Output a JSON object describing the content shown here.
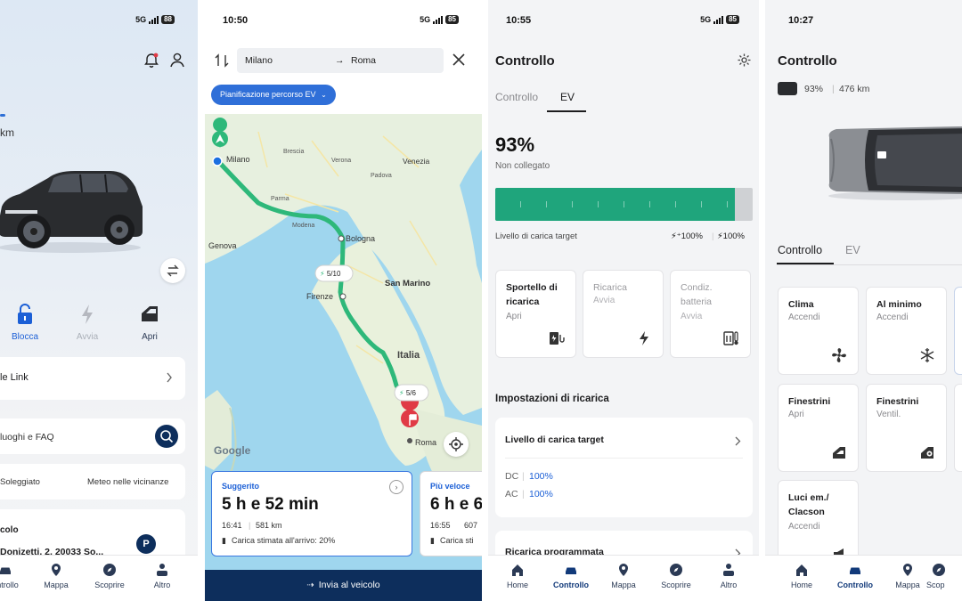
{
  "colors": {
    "ev_green": "#1fa57c",
    "brand_navy": "#0d2e5c",
    "route_green": "#2eb87a",
    "link_blue": "#1b5fd6",
    "map_pin_red": "#e03a45"
  },
  "screen1": {
    "status": {
      "network": "5G",
      "battery": "88"
    },
    "range_fragment": "km",
    "actions": [
      {
        "label": "Blocca",
        "icon": "lock-icon",
        "state": "active"
      },
      {
        "label": "Avvia",
        "icon": "bolt-icon",
        "state": "disabled"
      },
      {
        "label": "Apri",
        "icon": "door-icon",
        "state": "normal"
      }
    ],
    "link_row": "le Link",
    "faq_placeholder": "luoghi e FAQ",
    "weather": {
      "left": "Soleggiato",
      "right": "Meteo nelle vicinanze"
    },
    "location": {
      "title": "colo",
      "address": "Donizetti, 2, 20033 So..."
    },
    "tabs": [
      "ontrollo",
      "Mappa",
      "Scoprire",
      "Altro"
    ]
  },
  "screen2": {
    "status": {
      "time": "10:50",
      "network": "5G",
      "battery": "85"
    },
    "route": {
      "from": "Milano",
      "to": "Roma"
    },
    "chip": "Pianificazione percorso EV",
    "map_labels": {
      "cities": [
        "Milano",
        "Bologna",
        "Genova",
        "Firenze",
        "San Marino",
        "Italia",
        "Roma",
        "Venezia",
        "Modena",
        "Brescia",
        "Verona",
        "Padova",
        "Parma"
      ],
      "stops": [
        "5/10",
        "5/6"
      ],
      "brand": "Google"
    },
    "suggested": {
      "tag": "Suggerito",
      "duration": "5 h e 52 min",
      "arrival": "16:41",
      "distance": "581 km",
      "charge": "Carica stimata all'arrivo: 20%"
    },
    "faster": {
      "tag": "Più veloce",
      "duration": "6 h e 6",
      "arrival": "16:55",
      "distance": "607",
      "charge": "Carica sti"
    },
    "send_button": "Invia al veicolo"
  },
  "screen3": {
    "status": {
      "time": "10:55",
      "network": "5G",
      "battery": "85"
    },
    "header": "Controllo",
    "tabs": [
      "Controllo",
      "EV"
    ],
    "active_tab": "EV",
    "battery_percent": "93%",
    "plug_status": "Non collegato",
    "charge_level": 0.93,
    "target_label": "Livello di carica target",
    "target_dc": "100%",
    "target_ac": "100%",
    "tiles": [
      {
        "title": "Sportello di ricarica",
        "sub": "Apri",
        "icon": "charge-port-icon",
        "enabled": true
      },
      {
        "title": "Ricarica",
        "sub": "Avvia",
        "icon": "bolt-icon",
        "enabled": false
      },
      {
        "title": "Condiz. batteria",
        "sub": "Avvia",
        "icon": "battery-thermo-icon",
        "enabled": false
      }
    ],
    "section_title": "Impostazioni di ricarica",
    "target_card": {
      "title": "Livello di carica target",
      "dc_label": "DC",
      "dc_value": "100%",
      "ac_label": "AC",
      "ac_value": "100%"
    },
    "scheduled": "Ricarica programmata",
    "bottom_tabs": [
      "Home",
      "Controllo",
      "Mappa",
      "Scoprire",
      "Altro"
    ]
  },
  "screen4": {
    "status": {
      "time": "10:27"
    },
    "header": "Controllo",
    "battery": "93%",
    "range": "476 km",
    "tabs": [
      "Controllo",
      "EV"
    ],
    "active_tab": "Controllo",
    "tiles": [
      {
        "title": "Clima",
        "sub": "Accendi",
        "icon": "fan-icon"
      },
      {
        "title": "Al minimo",
        "sub": "Accendi",
        "icon": "snowflake-icon"
      },
      {
        "title": "Finestrini",
        "sub": "Apri",
        "icon": "window-open-icon"
      },
      {
        "title": "Finestrini",
        "sub": "Ventil.",
        "icon": "window-vent-icon"
      },
      {
        "title": "Luci em./ Clacson",
        "sub": "Accendi",
        "icon": "horn-icon"
      }
    ],
    "bottom_tabs": [
      "Home",
      "Controllo",
      "Mappa",
      "Scop"
    ]
  }
}
